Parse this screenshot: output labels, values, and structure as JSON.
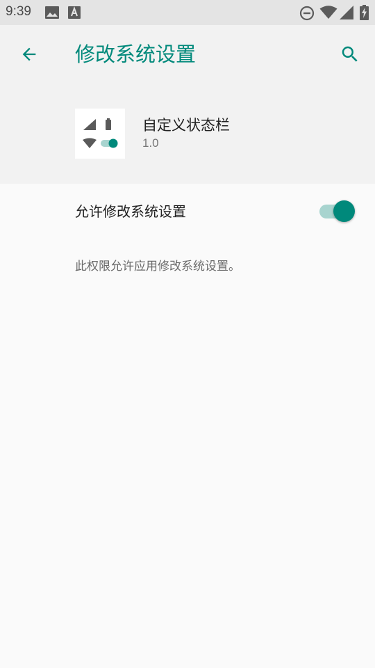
{
  "status_bar": {
    "time": "9:39",
    "left_icons": [
      "image-icon",
      "a-font-icon"
    ],
    "right_icons": [
      "do-not-disturb-icon",
      "wifi-icon",
      "signal-icon",
      "battery-charging-icon"
    ]
  },
  "toolbar": {
    "title": "修改系统设置",
    "back_icon": "arrow-back-icon",
    "search_icon": "search-icon"
  },
  "app": {
    "name": "自定义状态栏",
    "version": "1.0",
    "icon": "status-bar-app-icon"
  },
  "setting": {
    "label": "允许修改系统设置",
    "enabled": true,
    "description": "此权限允许应用修改系统设置。"
  },
  "colors": {
    "accent": "#00897b",
    "toggle_track": "#a8d4cf",
    "status_bar_bg": "#e4e4e4",
    "header_bg": "#f2f2f2",
    "page_bg": "#fafafa"
  }
}
